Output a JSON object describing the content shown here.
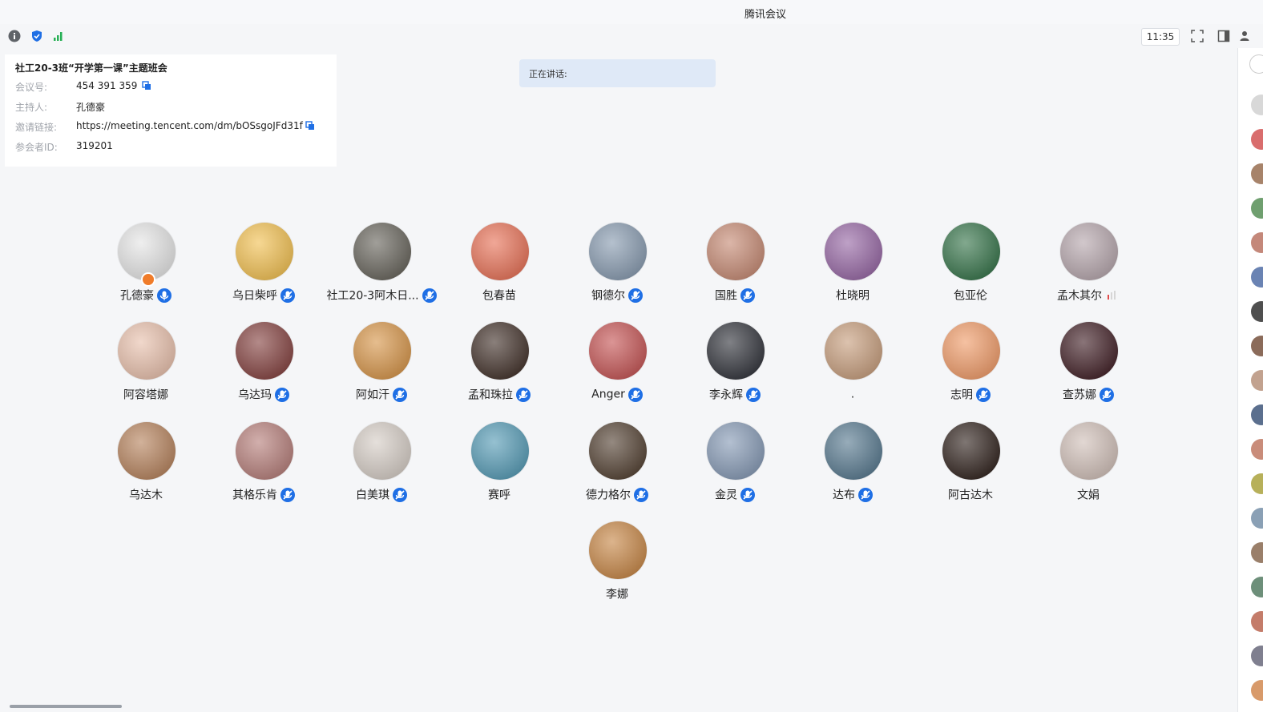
{
  "window": {
    "title": "腾讯会议"
  },
  "toolbar": {
    "clock": "11:35",
    "icons": [
      "info-icon",
      "shield-icon",
      "signal-icon"
    ],
    "right_icons": [
      "fullscreen-icon",
      "layout-icon",
      "participants-icon"
    ]
  },
  "meeting": {
    "title": "社工20-3班“开学第一课”主题班会",
    "rows": [
      {
        "label": "会议号:",
        "value": "454 391 359",
        "copy": true
      },
      {
        "label": "主持人:",
        "value": "孔德豪",
        "copy": false
      },
      {
        "label": "邀请链接:",
        "value": "https://meeting.tencent.com/dm/bOSsgoJFd31f",
        "copy": true
      },
      {
        "label": "参会者ID:",
        "value": "319201",
        "copy": false
      }
    ]
  },
  "speaking": {
    "label": "正在讲话:"
  },
  "participants": [
    {
      "name": "孔德豪",
      "mic": "speaking",
      "color": "#e6e6e6",
      "host": true
    },
    {
      "name": "乌日柴呼",
      "mic": "muted",
      "color": "#f2c35a"
    },
    {
      "name": "社工20-3阿木日...",
      "mic": "muted",
      "color": "#6e6b63"
    },
    {
      "name": "包春苗",
      "mic": "none",
      "color": "#e8785f"
    },
    {
      "name": "钢德尔",
      "mic": "muted",
      "color": "#8d9fb3"
    },
    {
      "name": "国胜",
      "mic": "muted",
      "color": "#c88f7a"
    },
    {
      "name": "杜晓明",
      "mic": "none",
      "color": "#9b6ea8"
    },
    {
      "name": "包亚伦",
      "mic": "none",
      "color": "#3f7a52"
    },
    {
      "name": "孟木其尔",
      "mic": "level",
      "color": "#b9aab0"
    },
    {
      "name": "阿容塔娜",
      "mic": "none",
      "color": "#e9c3b0"
    },
    {
      "name": "乌达玛",
      "mic": "muted",
      "color": "#8a4b49"
    },
    {
      "name": "阿如汗",
      "mic": "muted",
      "color": "#d89a52"
    },
    {
      "name": "孟和珠拉",
      "mic": "muted",
      "color": "#4b3b34"
    },
    {
      "name": "Anger",
      "mic": "muted",
      "color": "#c75c5c"
    },
    {
      "name": "李永辉",
      "mic": "muted",
      "color": "#3b3d44"
    },
    {
      "name": ".",
      "mic": "none",
      "color": "#c9a283"
    },
    {
      "name": "志明",
      "mic": "muted",
      "color": "#f0a070"
    },
    {
      "name": "查苏娜",
      "mic": "muted",
      "color": "#4a2a30"
    },
    {
      "name": "乌达木",
      "mic": "none",
      "color": "#b98864"
    },
    {
      "name": "其格乐肯",
      "mic": "muted",
      "color": "#b98480"
    },
    {
      "name": "白美琪",
      "mic": "muted",
      "color": "#d7cfc8"
    },
    {
      "name": "赛呼",
      "mic": "none",
      "color": "#5d9fb8"
    },
    {
      "name": "德力格尔",
      "mic": "muted",
      "color": "#5b4a3c"
    },
    {
      "name": "金灵",
      "mic": "muted",
      "color": "#8b9eb8"
    },
    {
      "name": "达布",
      "mic": "muted",
      "color": "#5f7f94"
    },
    {
      "name": "阿古达木",
      "mic": "none",
      "color": "#3a2d28"
    },
    {
      "name": "文娟",
      "mic": "none",
      "color": "#d2c2bb"
    },
    {
      "name": "李娜",
      "mic": "none",
      "color": "#c98c4f"
    }
  ],
  "strip_colors": [
    "#d8d8d8",
    "#d96d6d",
    "#a7836a",
    "#6f9f6f",
    "#c4887a",
    "#6a83b3",
    "#4f4f4f",
    "#8b6b5a",
    "#c2a28f",
    "#5b6f8e",
    "#c98c7a",
    "#b7b05a",
    "#8aa0b5",
    "#9a7f6a",
    "#6d8f7a",
    "#c47c6a",
    "#7f7f8f",
    "#d89a6a"
  ]
}
